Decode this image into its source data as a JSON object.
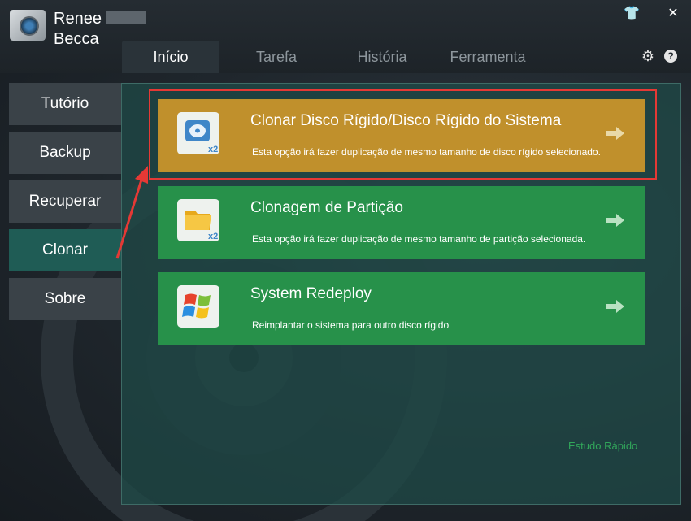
{
  "app": {
    "brand_line1": "Renee",
    "brand_line2": "Becca"
  },
  "window_controls": {
    "skin_glyph": "👕",
    "close_glyph": "✕"
  },
  "tabs": [
    {
      "label": "Início",
      "active": true
    },
    {
      "label": "Tarefa",
      "active": false
    },
    {
      "label": "História",
      "active": false
    },
    {
      "label": "Ferramenta",
      "active": false
    }
  ],
  "header_icons": {
    "settings": "gear-icon",
    "help": "?"
  },
  "sidebar": {
    "items": [
      {
        "label": "Tutório",
        "active": false
      },
      {
        "label": "Backup",
        "active": false
      },
      {
        "label": "Recuperar",
        "active": false
      },
      {
        "label": "Clonar",
        "active": true
      },
      {
        "label": "Sobre",
        "active": false
      }
    ]
  },
  "cards": [
    {
      "title": "Clonar Disco Rígido/Disco Rígido do Sistema",
      "description": "Esta opção irá fazer duplicação de mesmo tamanho de disco rígido selecionado.",
      "icon": "hard-disk-clone-icon",
      "badge": "x2",
      "color": "#c0902c",
      "highlighted": true
    },
    {
      "title": "Clonagem de Partição",
      "description": "Esta opção irá fazer duplicação de mesmo tamanho de partição selecionada.",
      "icon": "partition-clone-icon",
      "badge": "x2",
      "color": "#27914a",
      "highlighted": false
    },
    {
      "title": "System Redeploy",
      "description": "Reimplantar o sistema para outro disco rígido",
      "icon": "windows-logo-icon",
      "badge": "",
      "color": "#27914a",
      "highlighted": false
    }
  ],
  "footer": {
    "quick_study": "Estudo Rápido"
  },
  "colors": {
    "accent_green": "#27914a",
    "accent_orange": "#c0902c",
    "highlight_red": "#e53935",
    "active_sidebar": "#1f5c55"
  }
}
